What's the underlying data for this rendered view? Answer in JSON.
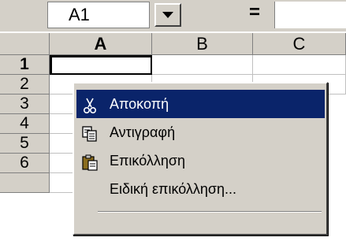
{
  "formula_bar": {
    "name_box": "A1",
    "equals": "="
  },
  "grid": {
    "columns": [
      "A",
      "B",
      "C"
    ],
    "rows": [
      "1",
      "2",
      "3",
      "4",
      "5",
      "6"
    ],
    "selected_cell": "A1"
  },
  "context_menu": {
    "items": [
      {
        "label": "Αποκοπή",
        "icon": "scissors-icon",
        "highlighted": true
      },
      {
        "label": "Αντιγραφή",
        "icon": "copy-icon"
      },
      {
        "label": "Επικόλληση",
        "icon": "paste-icon"
      },
      {
        "label": "Ειδική επικόλληση..."
      }
    ],
    "highlight_color": "#0a246a"
  }
}
